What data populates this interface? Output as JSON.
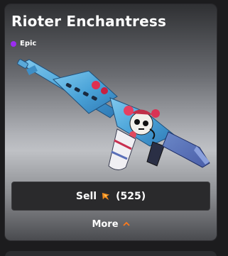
{
  "item": {
    "name": "Rioter Enchantress",
    "rarity": "Epic",
    "rarity_color": "#9b2cf0",
    "image": "rifle-skin-image"
  },
  "actions": {
    "sell_label": "Sell",
    "sell_price": "(525)",
    "currency_icon": "coin-icon",
    "more_label": "More",
    "more_icon": "chevron-up-icon",
    "accent_color": "#ff7a1a"
  }
}
